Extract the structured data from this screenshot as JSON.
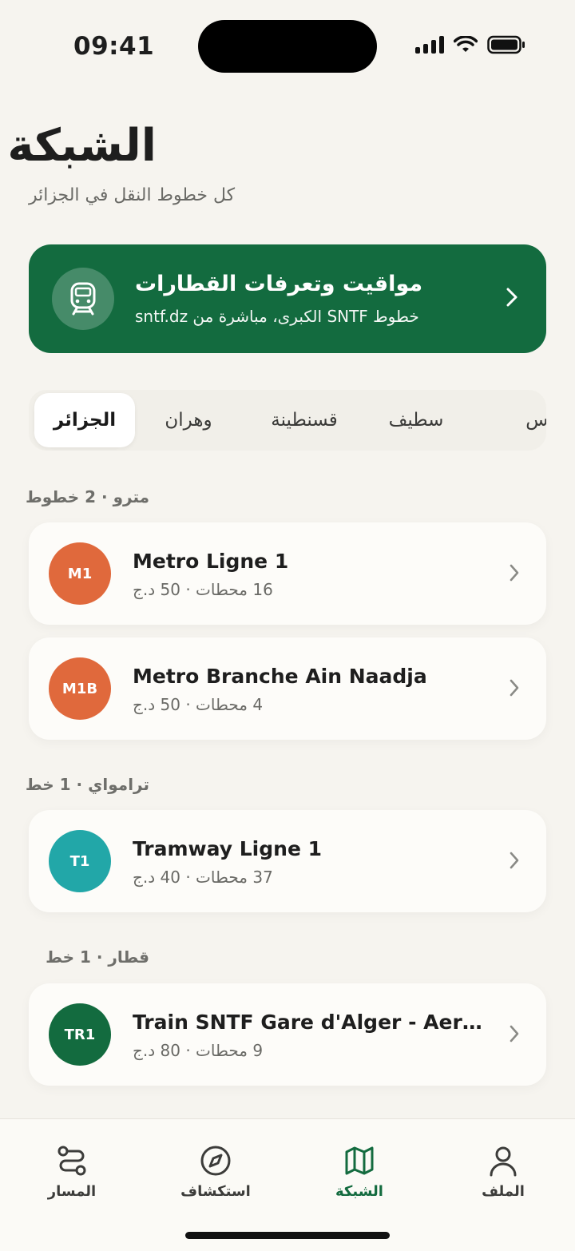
{
  "status_bar": {
    "time": "09:41"
  },
  "header": {
    "title": "الشبكة",
    "subtitle": "كل خطوط النقل في الجزائر"
  },
  "banner": {
    "title": "مواقيت وتعرفات القطارات",
    "subtitle": "خطوط SNTF الكبرى، مباشرة من sntf.dz",
    "icon": "train-icon"
  },
  "cities": [
    {
      "label": "الجزائر",
      "active": true
    },
    {
      "label": "وهران",
      "active": false
    },
    {
      "label": "قسنطينة",
      "active": false
    },
    {
      "label": "سطيف",
      "active": false
    },
    {
      "label": "عباس",
      "active": false
    }
  ],
  "sections": [
    {
      "title": "مترو · 2 خطوط",
      "lines": [
        {
          "code": "M1",
          "name": "Metro Ligne 1",
          "meta": "16 محطات · 50 د.ج",
          "color": "#E0693C"
        },
        {
          "code": "M1B",
          "name": "Metro Branche Ain Naadja",
          "meta": "4 محطات · 50 د.ج",
          "color": "#E0693C"
        }
      ]
    },
    {
      "title": "ترامواي · 1 خط",
      "lines": [
        {
          "code": "T1",
          "name": "Tramway Ligne 1",
          "meta": "37 محطات · 40 د.ج",
          "color": "#22A7A8"
        }
      ]
    },
    {
      "title": "قطار · 1 خط",
      "lines": [
        {
          "code": "TR1",
          "name": "Train SNTF Gare d'Alger - Aerop...",
          "meta": "9 محطات · 80 د.ج",
          "color": "#136B3F"
        }
      ]
    }
  ],
  "bottom_nav": [
    {
      "label": "المسار",
      "icon": "route-icon",
      "active": false
    },
    {
      "label": "استكشاف",
      "icon": "compass-icon",
      "active": false
    },
    {
      "label": "الشبكة",
      "icon": "map-icon",
      "active": true
    },
    {
      "label": "الملف",
      "icon": "user-icon",
      "active": false
    }
  ],
  "colors": {
    "brand_green": "#136B3F",
    "metro_orange": "#E0693C",
    "tram_teal": "#22A7A8",
    "background": "#F6F4EF"
  }
}
